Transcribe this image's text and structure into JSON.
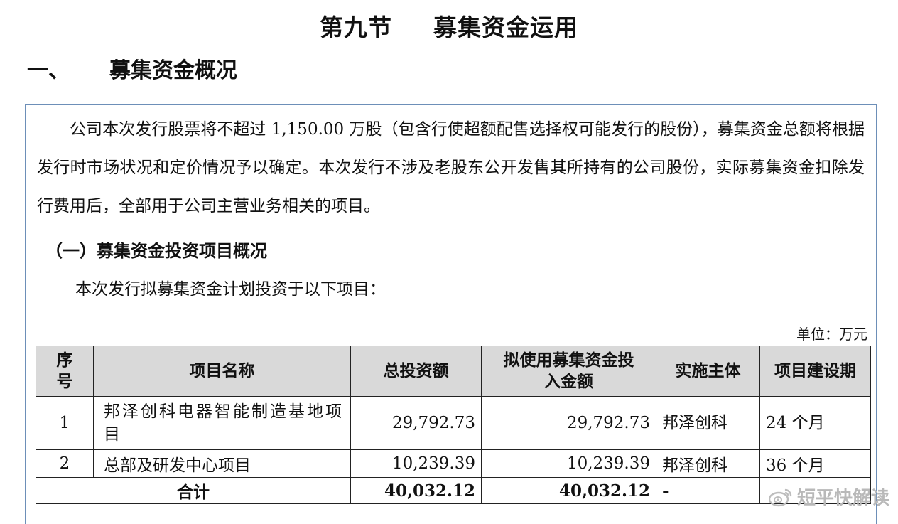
{
  "header": {
    "chapter": "第九节",
    "chapter_title": "募集资金运用",
    "section_no": "一、",
    "section_title": "募集资金概况"
  },
  "body": {
    "paragraph": "公司本次发行股票将不超过 1,150.00 万股（包含行使超额配售选择权可能发行的股份），募集资金总额将根据发行时市场状况和定价情况予以确定。本次发行不涉及老股东公开发售其所持有的公司股份，实际募集资金扣除发行费用后，全部用于公司主营业务相关的项目。",
    "subsection": "（一）募集资金投资项目概况",
    "intro": "本次发行拟募集资金计划投资于以下项目：",
    "unit": "单位：万元"
  },
  "table": {
    "headers": [
      "序号",
      "项目名称",
      "总投资额",
      "拟使用募集资金投入金额",
      "实施主体",
      "项目建设期"
    ],
    "rows": [
      [
        "1",
        "邦泽创科电器智能制造基地项目",
        "29,792.73",
        "29,792.73",
        "邦泽创科",
        "24 个月"
      ],
      [
        "2",
        "总部及研发中心项目",
        "10,239.39",
        "10,239.39",
        "邦泽创科",
        "36 个月"
      ]
    ],
    "total": {
      "label": "合计",
      "total_investment": "40,032.12",
      "raised_funds": "40,032.12",
      "entity": "-"
    }
  },
  "watermark": {
    "text": "短平快解读",
    "icon": "weibo-logo"
  }
}
